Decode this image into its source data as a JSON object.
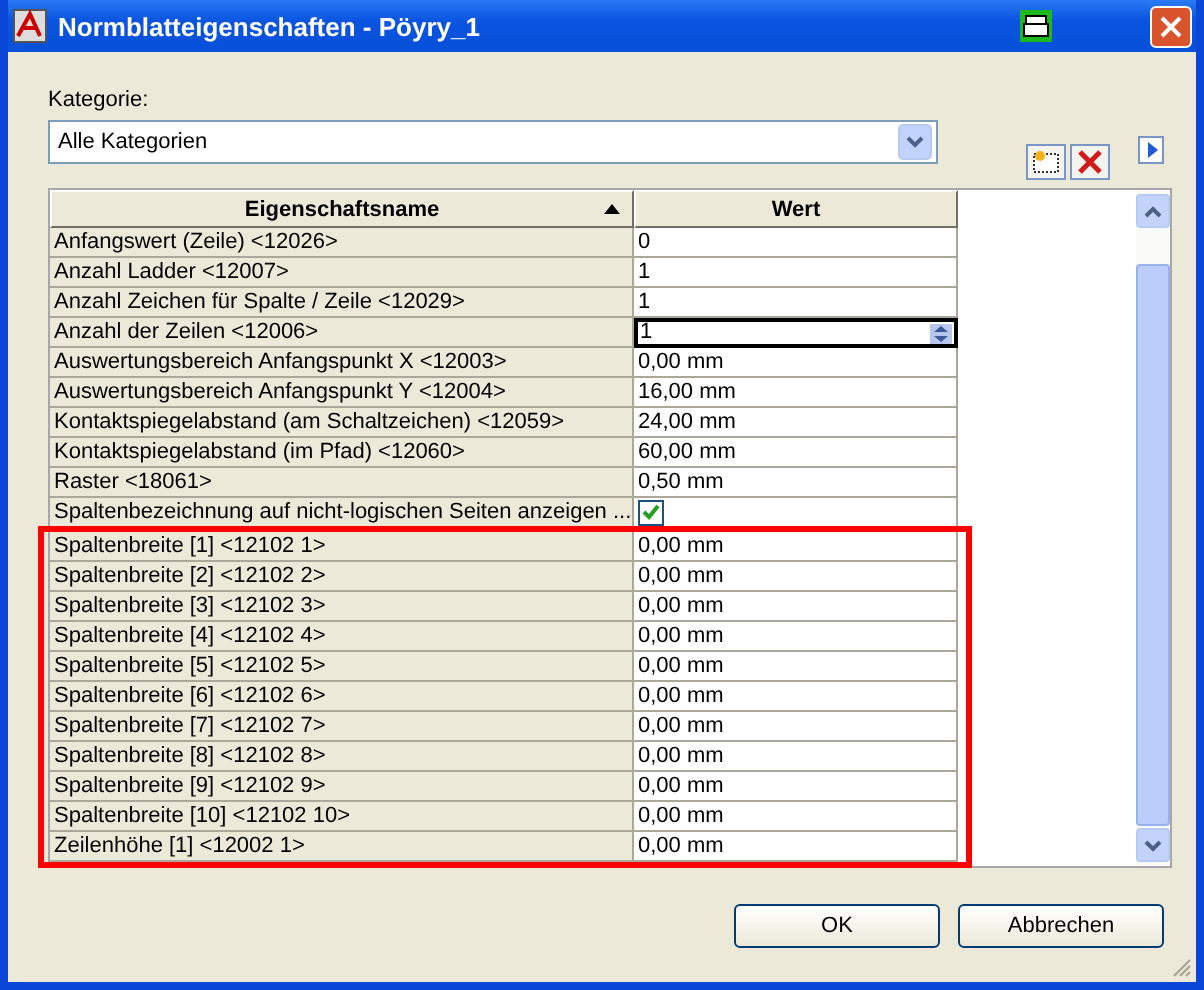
{
  "window": {
    "title": "Normblatteigenschaften - Pöyry_1"
  },
  "category": {
    "label": "Kategorie:",
    "value": "Alle Kategorien"
  },
  "table": {
    "columns": [
      {
        "label": "Eigenschaftsname",
        "sorted": true
      },
      {
        "label": "Wert",
        "sorted": false
      }
    ],
    "rows": [
      {
        "kind": "text",
        "name": "Anfangswert (Zeile) <12026>",
        "value": "0",
        "highlighted": false
      },
      {
        "kind": "text",
        "name": "Anzahl Ladder <12007>",
        "value": "1",
        "highlighted": false
      },
      {
        "kind": "text",
        "name": "Anzahl Zeichen für Spalte / Zeile <12029>",
        "value": "1",
        "highlighted": false
      },
      {
        "kind": "spin",
        "name": "Anzahl der Zeilen <12006>",
        "value": "1",
        "highlighted": false
      },
      {
        "kind": "text",
        "name": "Auswertungsbereich Anfangspunkt X <12003>",
        "value": "0,00 mm",
        "highlighted": false
      },
      {
        "kind": "text",
        "name": "Auswertungsbereich Anfangspunkt Y <12004>",
        "value": "16,00 mm",
        "highlighted": false
      },
      {
        "kind": "text",
        "name": "Kontaktspiegelabstand (am Schaltzeichen) <12059>",
        "value": "24,00 mm",
        "highlighted": false
      },
      {
        "kind": "text",
        "name": "Kontaktspiegelabstand (im Pfad) <12060>",
        "value": "60,00 mm",
        "highlighted": false
      },
      {
        "kind": "text",
        "name": "Raster <18061>",
        "value": "0,50 mm",
        "highlighted": false
      },
      {
        "kind": "checkbox",
        "name": "Spaltenbezeichnung auf nicht-logischen Seiten anzeigen ...",
        "checked": true,
        "highlighted": false
      },
      {
        "kind": "text",
        "name": "Spaltenbreite [1] <12102 1>",
        "value": "0,00 mm",
        "highlighted": true
      },
      {
        "kind": "text",
        "name": "Spaltenbreite [2] <12102 2>",
        "value": "0,00 mm",
        "highlighted": true
      },
      {
        "kind": "text",
        "name": "Spaltenbreite [3] <12102 3>",
        "value": "0,00 mm",
        "highlighted": true
      },
      {
        "kind": "text",
        "name": "Spaltenbreite [4] <12102 4>",
        "value": "0,00 mm",
        "highlighted": true
      },
      {
        "kind": "text",
        "name": "Spaltenbreite [5] <12102 5>",
        "value": "0,00 mm",
        "highlighted": true
      },
      {
        "kind": "text",
        "name": "Spaltenbreite [6] <12102 6>",
        "value": "0,00 mm",
        "highlighted": true
      },
      {
        "kind": "text",
        "name": "Spaltenbreite [7] <12102 7>",
        "value": "0,00 mm",
        "highlighted": true
      },
      {
        "kind": "text",
        "name": "Spaltenbreite [8] <12102 8>",
        "value": "0,00 mm",
        "highlighted": true
      },
      {
        "kind": "text",
        "name": "Spaltenbreite [9] <12102 9>",
        "value": "0,00 mm",
        "highlighted": true
      },
      {
        "kind": "text",
        "name": "Spaltenbreite [10] <12102 10>",
        "value": "0,00 mm",
        "highlighted": true
      },
      {
        "kind": "text",
        "name": "Zeilenhöhe [1] <12002 1>",
        "value": "0,00 mm",
        "highlighted": true
      }
    ]
  },
  "buttons": [
    "OK",
    "Abbrechen"
  ]
}
